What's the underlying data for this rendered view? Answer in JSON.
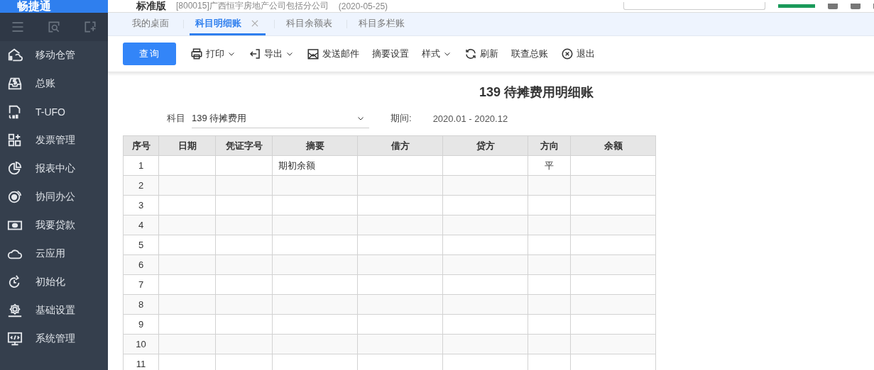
{
  "header": {
    "logo": "畅捷通",
    "edition": "标准版",
    "company": "[800015]广西恒宇房地产公司包括分公司",
    "date": "(2020-05-25)"
  },
  "sidebar": {
    "items": [
      {
        "label": "移动仓管"
      },
      {
        "label": "总账"
      },
      {
        "label": "T-UFO"
      },
      {
        "label": "发票管理"
      },
      {
        "label": "报表中心"
      },
      {
        "label": "协同办公"
      },
      {
        "label": "我要贷款"
      },
      {
        "label": "云应用"
      },
      {
        "label": "初始化"
      },
      {
        "label": "基础设置"
      },
      {
        "label": "系统管理"
      }
    ]
  },
  "tabs": [
    {
      "label": "我的桌面",
      "selected": false
    },
    {
      "label": "科目明细账",
      "selected": true
    },
    {
      "label": "科目余额表",
      "selected": false
    },
    {
      "label": "科目多栏账",
      "selected": false
    }
  ],
  "toolbar": [
    {
      "label": "查询",
      "kind": "primary"
    },
    {
      "label": "打印",
      "kind": "menu"
    },
    {
      "label": "导出",
      "kind": "menu"
    },
    {
      "label": "发送邮件",
      "kind": "plain"
    },
    {
      "label": "摘要设置",
      "kind": "plain"
    },
    {
      "label": "样式",
      "kind": "menu"
    },
    {
      "label": "刷新",
      "kind": "plain"
    },
    {
      "label": "联查总账",
      "kind": "plain"
    },
    {
      "label": "退出",
      "kind": "plain"
    }
  ],
  "report": {
    "title": "139 待摊费用明细账",
    "subject_label": "科目",
    "subject_value": "139 待摊费用",
    "period_label": "期间:",
    "period_value": "2020.01 - 2020.12"
  },
  "table": {
    "columns": [
      "序号",
      "日期",
      "凭证字号",
      "摘要",
      "借方",
      "贷方",
      "方向",
      "余额"
    ],
    "rows": [
      {
        "no": "1",
        "summary": "期初余额",
        "direction": "平"
      },
      {
        "no": "2"
      },
      {
        "no": "3"
      },
      {
        "no": "4"
      },
      {
        "no": "5"
      },
      {
        "no": "6"
      },
      {
        "no": "7"
      },
      {
        "no": "8"
      },
      {
        "no": "9"
      },
      {
        "no": "10"
      },
      {
        "no": "11"
      }
    ]
  }
}
